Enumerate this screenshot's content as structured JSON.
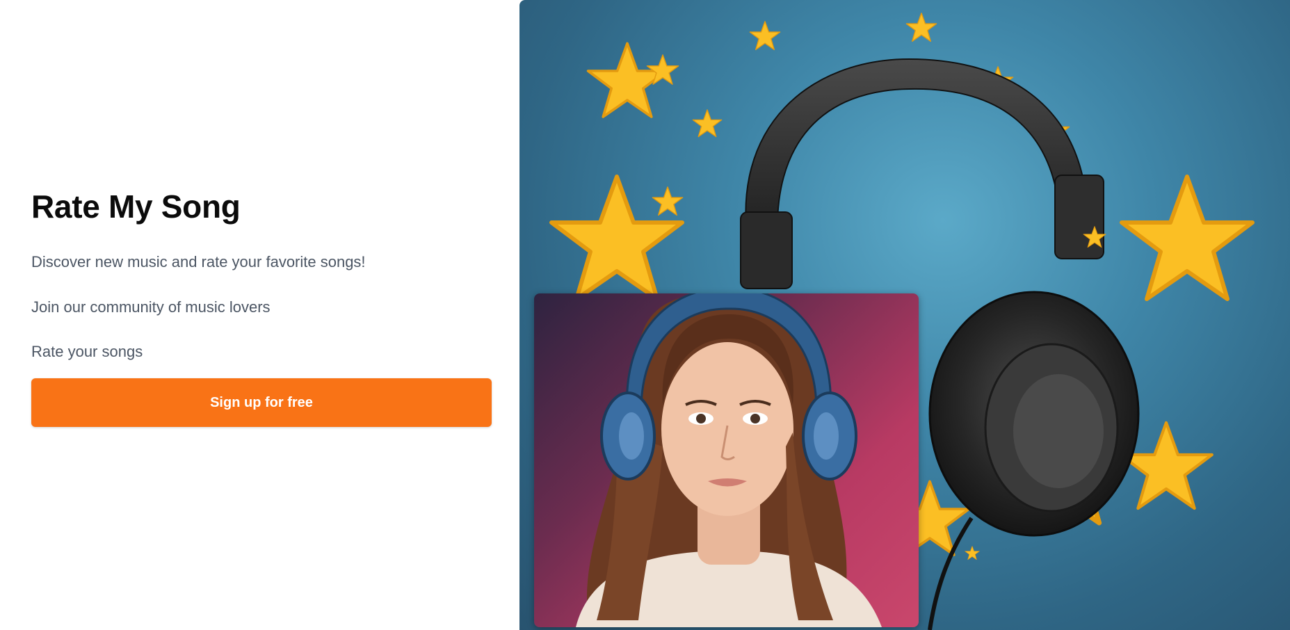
{
  "hero": {
    "title": "Rate My Song",
    "lines": [
      "Discover new music and rate your favorite songs!",
      "Join our community of music lovers",
      "Rate your songs"
    ],
    "cta_label": "Sign up for free"
  },
  "colors": {
    "accent": "#f97316",
    "title": "#0b0b0b",
    "body_text": "#4b5563",
    "art_background": "#3f86a8",
    "star": "#fbbf24",
    "portrait_background": "#b83a63"
  },
  "images": {
    "hero_art": "headphones-stars-illustration",
    "portrait": "woman-with-headphones-photo"
  }
}
